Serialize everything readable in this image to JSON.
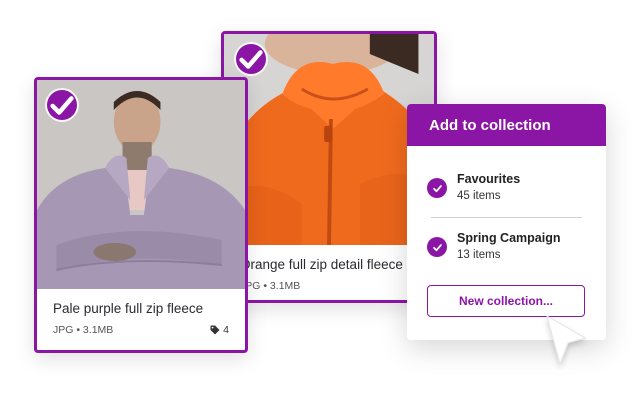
{
  "cards": [
    {
      "id": "back",
      "title": "Orange full zip detail fleece",
      "file_info": "JPG • 3.1MB",
      "selected": true,
      "check_icon": "checkmark-icon"
    },
    {
      "id": "front",
      "title": "Pale purple full zip fleece",
      "file_info": "JPG • 3.1MB",
      "tag_count": "4",
      "tag_icon": "tag-icon",
      "selected": true,
      "check_icon": "checkmark-icon"
    }
  ],
  "popover": {
    "title": "Add to collection",
    "collections": [
      {
        "name": "Favourites",
        "count": "45 items",
        "selected": true
      },
      {
        "name": "Spring Campaign",
        "count": "13 items",
        "selected": true
      }
    ],
    "new_button_label": "New collection..."
  },
  "colors": {
    "accent": "#8b16a5",
    "fleece_orange": "#f06a1e",
    "fleece_purple": "#a697b4"
  },
  "icons": {
    "cursor": "arrow-cursor-icon"
  }
}
